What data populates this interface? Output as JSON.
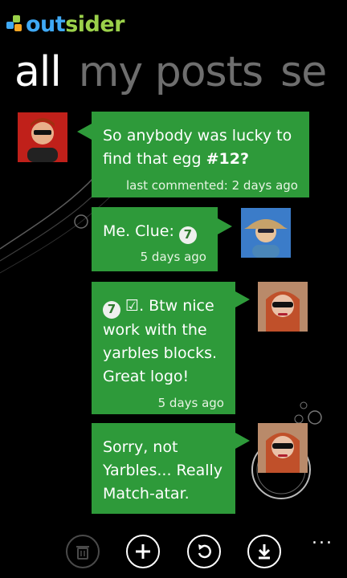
{
  "app": {
    "logo_part1": "out",
    "logo_part2": "sider"
  },
  "pivot": {
    "items": [
      "all",
      "my posts",
      "se"
    ],
    "active_index": 0
  },
  "messages": [
    {
      "text_before": "So anybody was lucky to find that egg ",
      "text_bold": "#12?",
      "meta": "last commented: 2 days ago"
    },
    {
      "text": "Me. Clue: ",
      "badge": "7",
      "meta": "5 days ago"
    },
    {
      "badge": "7",
      "text": " ☑. Btw nice work with the yarbles blocks. Great logo!",
      "meta": "5 days ago"
    },
    {
      "text": "Sorry, not Yarbles... Really Match-atar."
    }
  ],
  "appbar": {
    "buttons": [
      {
        "icon": "delete-icon",
        "enabled": false
      },
      {
        "icon": "add-icon",
        "enabled": true
      },
      {
        "icon": "refresh-icon",
        "enabled": true
      },
      {
        "icon": "download-icon",
        "enabled": true
      }
    ],
    "more": "..."
  },
  "colors": {
    "bubble": "#2e9a3a",
    "background": "#000000",
    "accent_blue": "#3fa9f5",
    "accent_green": "#9bd14a"
  }
}
